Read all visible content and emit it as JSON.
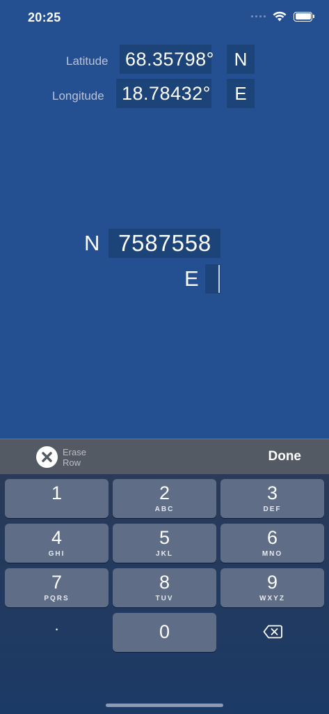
{
  "status_bar": {
    "time": "20:25"
  },
  "coordinates": {
    "latitude": {
      "label": "Latitude",
      "value": "68.35798°",
      "hemisphere": "N"
    },
    "longitude": {
      "label": "Longitude",
      "value": "18.78432°",
      "hemisphere": "E"
    }
  },
  "utm": {
    "northing": {
      "letter": "N",
      "value": "7587558"
    },
    "easting": {
      "letter": "E",
      "value": ""
    }
  },
  "toolbar": {
    "erase_label": "Erase Row",
    "done_label": "Done"
  },
  "keypad": {
    "keys": [
      {
        "digit": "1",
        "letters": ""
      },
      {
        "digit": "2",
        "letters": "ABC"
      },
      {
        "digit": "3",
        "letters": "DEF"
      },
      {
        "digit": "4",
        "letters": "GHI"
      },
      {
        "digit": "5",
        "letters": "JKL"
      },
      {
        "digit": "6",
        "letters": "MNO"
      },
      {
        "digit": "7",
        "letters": "PQRS"
      },
      {
        "digit": "8",
        "letters": "TUV"
      },
      {
        "digit": "9",
        "letters": "WXYZ"
      }
    ],
    "decimal": ".",
    "zero": "0"
  },
  "colors": {
    "background": "#244f91",
    "field": "#1d4478",
    "key": "#5f6d87",
    "toolbar": "#535a63"
  }
}
